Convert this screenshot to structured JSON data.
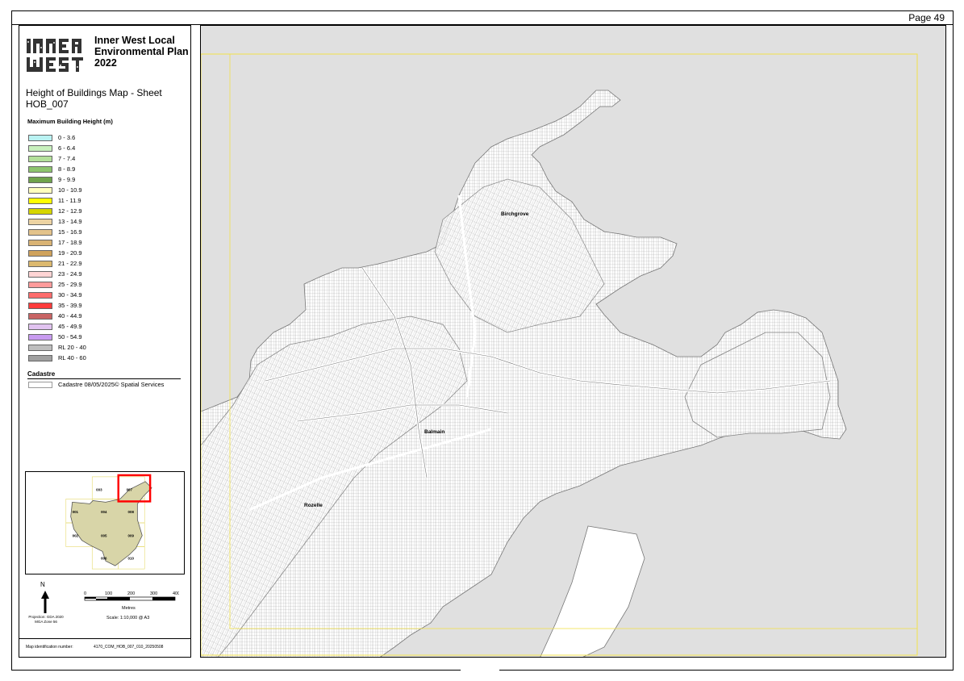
{
  "page_number": "Page 49",
  "logo": {
    "text": "INNER WEST"
  },
  "plan_title": "Inner West Local Environmental Plan 2022",
  "map_title": "Height of Buildings Map - Sheet HOB_007",
  "legend": {
    "heading": "Maximum Building Height (m)",
    "items": [
      {
        "label": "0 - 3.6",
        "color": "#b9f2f2"
      },
      {
        "label": "6 - 6.4",
        "color": "#c8f0bd"
      },
      {
        "label": "7 - 7.4",
        "color": "#b3e09a"
      },
      {
        "label": "8 - 8.9",
        "color": "#8dc46e"
      },
      {
        "label": "9 - 9.9",
        "color": "#6fa34c"
      },
      {
        "label": "10 - 10.9",
        "color": "#ffffbe"
      },
      {
        "label": "11 - 11.9",
        "color": "#ffff00"
      },
      {
        "label": "12 - 12.9",
        "color": "#d6d600"
      },
      {
        "label": "13 - 14.9",
        "color": "#ecd3a3"
      },
      {
        "label": "15 - 16.9",
        "color": "#e3c38b"
      },
      {
        "label": "17 - 18.9",
        "color": "#d9b374"
      },
      {
        "label": "19 - 20.9",
        "color": "#cfa25c"
      },
      {
        "label": "21 - 22.9",
        "color": "#dcb96f"
      },
      {
        "label": "23 - 24.9",
        "color": "#ffd5d5"
      },
      {
        "label": "25 - 29.9",
        "color": "#ff9b9b"
      },
      {
        "label": "30 - 34.9",
        "color": "#ff6d6d"
      },
      {
        "label": "35 - 39.9",
        "color": "#ff3c3c"
      },
      {
        "label": "40 - 44.9",
        "color": "#c86464"
      },
      {
        "label": "45 - 49.9",
        "color": "#e1c3f0"
      },
      {
        "label": "50 - 54.9",
        "color": "#c89bf0"
      },
      {
        "label": "RL 20 - 40",
        "color": "#bebebe"
      },
      {
        "label": "RL 40 - 60",
        "color": "#a0a0a0"
      }
    ]
  },
  "cadastre": {
    "heading": "Cadastre",
    "label": "Cadastre 08/05/2025© Spatial Services"
  },
  "locator": {
    "sheets": [
      {
        "id": "003"
      },
      {
        "id": "007"
      },
      {
        "id": "001"
      },
      {
        "id": "004"
      },
      {
        "id": "008"
      },
      {
        "id": "002"
      },
      {
        "id": "005"
      },
      {
        "id": "009"
      },
      {
        "id": "006"
      },
      {
        "id": "010"
      }
    ],
    "highlight_sheet": "007"
  },
  "north_label": "N",
  "scale": {
    "ticks": [
      "0",
      "100",
      "200",
      "300",
      "400"
    ],
    "unit": "Metres",
    "ratio": "Scale: 1:10,000 @ A3"
  },
  "projection": {
    "line1": "Projection: GDA 2020",
    "line2": "MGA Zone 56"
  },
  "map_id": {
    "label": "Map identification number:",
    "value": "4170_COM_HOB_007_010_20250508"
  },
  "suburbs": [
    {
      "name": "Birchgrove"
    },
    {
      "name": "Balmain"
    },
    {
      "name": "Rozelle"
    }
  ],
  "colors": {
    "water": "#e0e0e0",
    "land": "#ffffff",
    "frame": "#f2e24a",
    "highlight": "#ff0000"
  }
}
